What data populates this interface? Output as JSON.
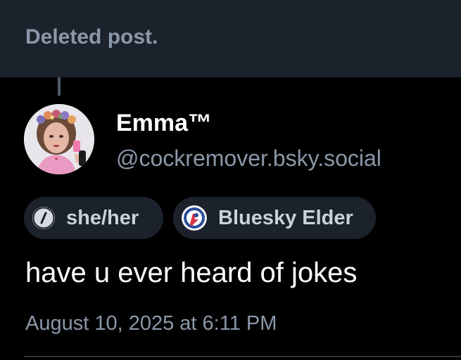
{
  "parent": {
    "label": "Deleted post."
  },
  "author": {
    "display_name": "Emma™",
    "handle": "@cockremover.bsky.social",
    "avatar_icon": "avatar-photo"
  },
  "badges": [
    {
      "label": "she/her",
      "icon": "slash-icon"
    },
    {
      "label": "Bluesky Elder",
      "icon": "bluesky-elder-badge-icon"
    }
  ],
  "post": {
    "text": "have u ever heard of jokes",
    "timestamp": "August 10, 2025 at 6:11 PM"
  },
  "colors": {
    "background": "#000000",
    "banner": "#1c222b",
    "muted_text": "#8b98a9",
    "pill_background": "#1c222b",
    "pill_text": "#c9d1da"
  }
}
